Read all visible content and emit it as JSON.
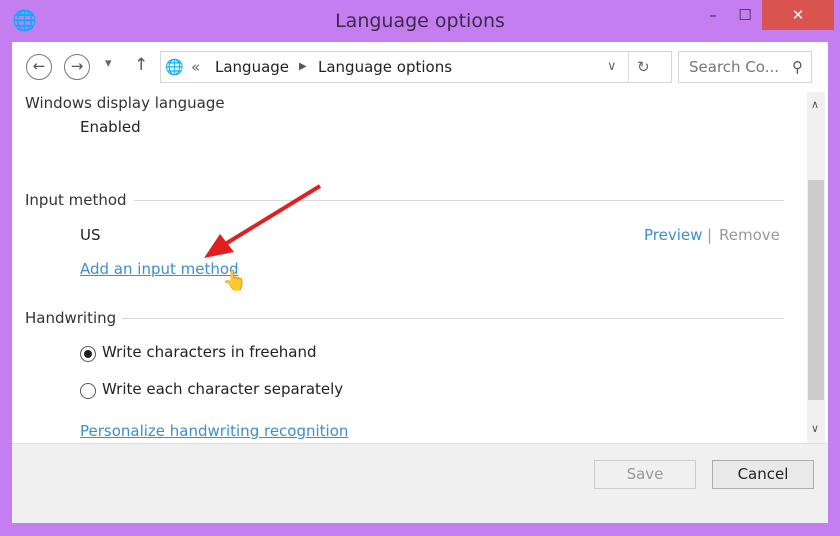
{
  "window": {
    "title": "Language options",
    "minimize": "–",
    "maximize": "☐",
    "close": "✕"
  },
  "nav": {
    "back": "←",
    "forward": "→",
    "dropdown": "▾",
    "up": "↑",
    "overflow": "«",
    "crumbs": [
      "Language",
      "Language options"
    ],
    "search_placeholder": "Search Co..."
  },
  "content": {
    "display_language": {
      "heading": "Windows display language",
      "status": "Enabled"
    },
    "input_method": {
      "heading": "Input method",
      "item": "US",
      "preview": "Preview",
      "separator": "|",
      "remove": "Remove",
      "add_link": "Add an input method"
    },
    "handwriting": {
      "heading": "Handwriting",
      "options": [
        {
          "label": "Write characters in freehand",
          "selected": true
        },
        {
          "label": "Write each character separately",
          "selected": false
        }
      ],
      "personalize_link": "Personalize handwriting recognition"
    }
  },
  "footer": {
    "save": "Save",
    "cancel": "Cancel"
  },
  "colors": {
    "frame": "#c47ef0",
    "link": "#3a8fd0",
    "close": "#d9534f",
    "arrow": "#e02020"
  }
}
